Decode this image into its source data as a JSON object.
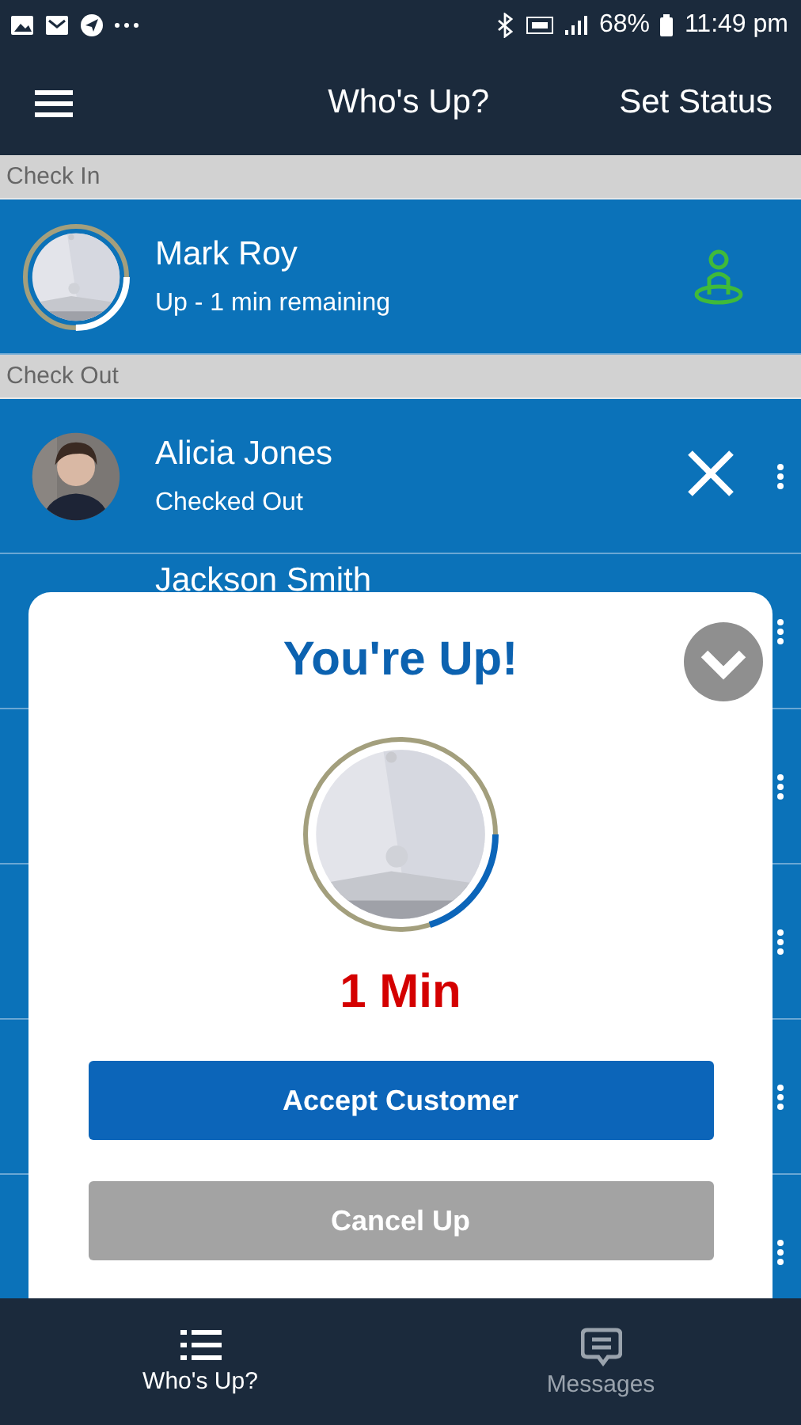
{
  "status_bar": {
    "battery": "68%",
    "time": "11:49 pm"
  },
  "app_bar": {
    "title": "Who's Up?",
    "action": "Set Status"
  },
  "sections": [
    {
      "title": "Check In",
      "rows": [
        {
          "kind": "up",
          "name": "Mark Roy",
          "status": "Up - 1 min remaining",
          "level": 0.25
        }
      ]
    },
    {
      "title": "Check Out",
      "rows": [
        {
          "kind": "checked_out",
          "name": "Alicia Jones",
          "status": "Checked Out"
        },
        {
          "kind": "covered",
          "name": "Jackson Smith"
        },
        {
          "kind": "covered"
        },
        {
          "kind": "covered"
        },
        {
          "kind": "covered"
        },
        {
          "kind": "covered"
        }
      ]
    }
  ],
  "modal": {
    "title": "You're Up!",
    "timer": "1 Min",
    "level": 0.2,
    "buttons": [
      {
        "label": "Accept Customer",
        "kind": "primary"
      },
      {
        "label": "Cancel Up",
        "kind": "secondary"
      }
    ]
  },
  "bottom_nav": [
    {
      "label": "Who's Up?",
      "kind": "list",
      "selected": true
    },
    {
      "label": "Messages",
      "kind": "chat",
      "selected": false
    }
  ]
}
